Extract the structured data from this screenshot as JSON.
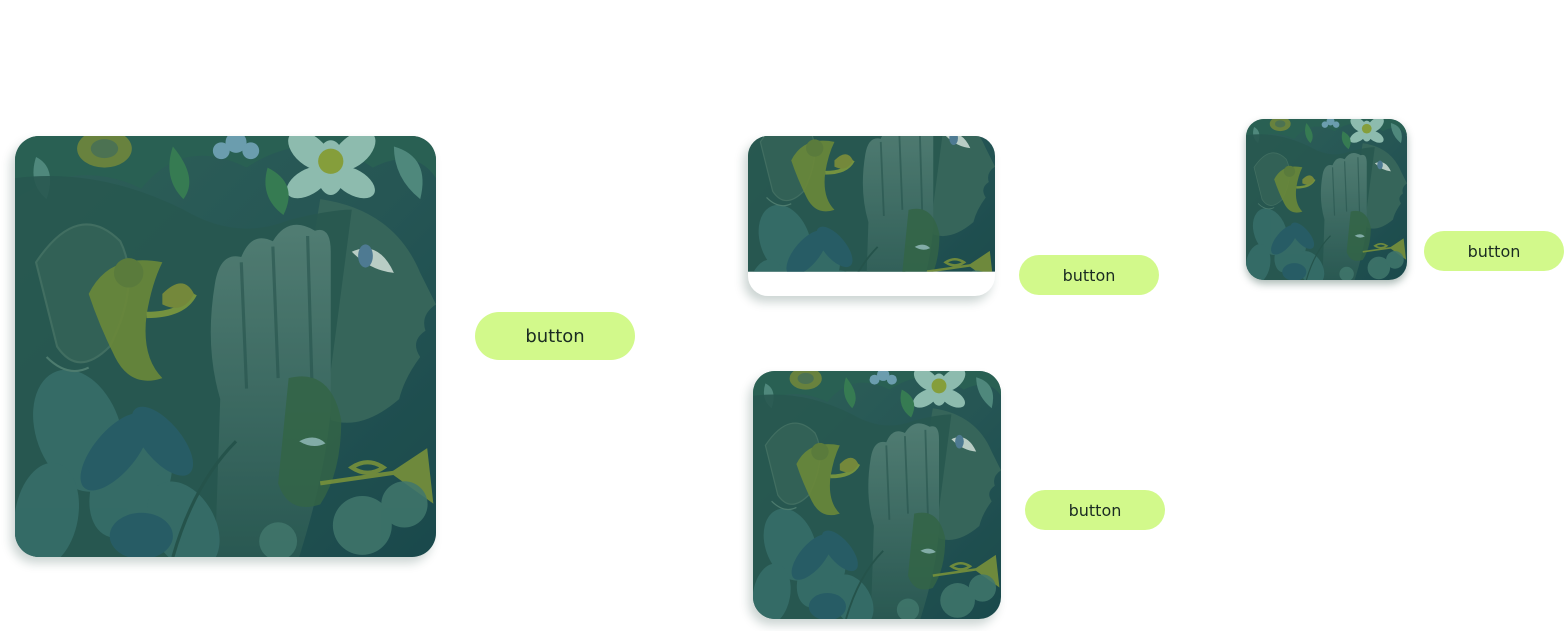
{
  "colors": {
    "button_bg": "#d2f98b",
    "button_text": "#1a2b22",
    "art_base": "#2c5d57",
    "art_dark": "#1a4d4c",
    "art_face": "#3c6b60",
    "art_leaf": "#4f8a7e",
    "art_flower": "#9ed1c0",
    "art_accent": "#9bb43a"
  },
  "cards": [
    {
      "button_label": "button",
      "image": "forest-portrait-illustration"
    },
    {
      "button_label": "button",
      "image": "forest-portrait-illustration"
    },
    {
      "button_label": "button",
      "image": "forest-portrait-illustration"
    },
    {
      "button_label": "button",
      "image": "forest-portrait-illustration"
    }
  ]
}
